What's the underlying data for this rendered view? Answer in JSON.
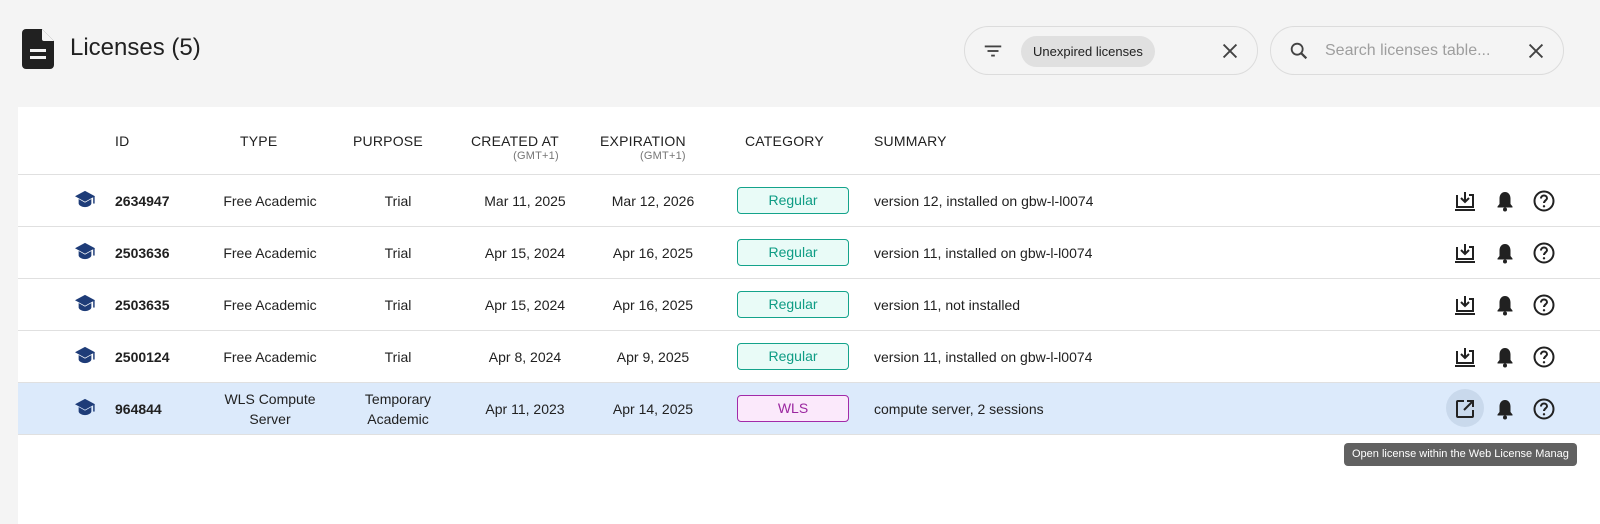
{
  "header": {
    "title": "Licenses (5)",
    "filter_chip": "Unexpired licenses",
    "search_placeholder": "Search licenses table..."
  },
  "table": {
    "columns": {
      "id": "ID",
      "type": "TYPE",
      "purpose": "PURPOSE",
      "created_at": "CREATED AT",
      "created_at_tz": "(GMT+1)",
      "expiration": "EXPIRATION",
      "expiration_tz": "(GMT+1)",
      "category": "CATEGORY",
      "summary": "SUMMARY"
    },
    "rows": [
      {
        "id": "2634947",
        "type": "Free Academic",
        "purpose": "Trial",
        "created": "Mar 11, 2025",
        "expiration": "Mar 12, 2026",
        "category": "Regular",
        "summary": "version 12, installed on gbw-l-l0074"
      },
      {
        "id": "2503636",
        "type": "Free Academic",
        "purpose": "Trial",
        "created": "Apr 15, 2024",
        "expiration": "Apr 16, 2025",
        "category": "Regular",
        "summary": "version 11, installed on gbw-l-l0074"
      },
      {
        "id": "2503635",
        "type": "Free Academic",
        "purpose": "Trial",
        "created": "Apr 15, 2024",
        "expiration": "Apr 16, 2025",
        "category": "Regular",
        "summary": "version 11, not installed"
      },
      {
        "id": "2500124",
        "type": "Free Academic",
        "purpose": "Trial",
        "created": "Apr 8, 2024",
        "expiration": "Apr 9, 2025",
        "category": "Regular",
        "summary": "version 11, installed on gbw-l-l0074"
      },
      {
        "id": "964844",
        "type_line1": "WLS Compute",
        "type_line2": "Server",
        "purpose_line1": "Temporary",
        "purpose_line2": "Academic",
        "created": "Apr 11, 2023",
        "expiration": "Apr 14, 2025",
        "category": "WLS",
        "summary": "compute server, 2 sessions"
      }
    ]
  },
  "tooltip": "Open license within the Web License Manag",
  "icons": {
    "page": "document-icon",
    "filter": "filter-icon",
    "search": "search-icon",
    "clear": "close-icon",
    "row": "graduation-cap-icon",
    "download": "download-icon",
    "open": "open-external-icon",
    "notify": "bell-icon",
    "help": "help-icon"
  },
  "colors": {
    "accent_blue": "#1e3c78",
    "regular_badge": "#0e9c84",
    "wls_badge": "#9b27a0",
    "selected_row": "#dceafb"
  }
}
